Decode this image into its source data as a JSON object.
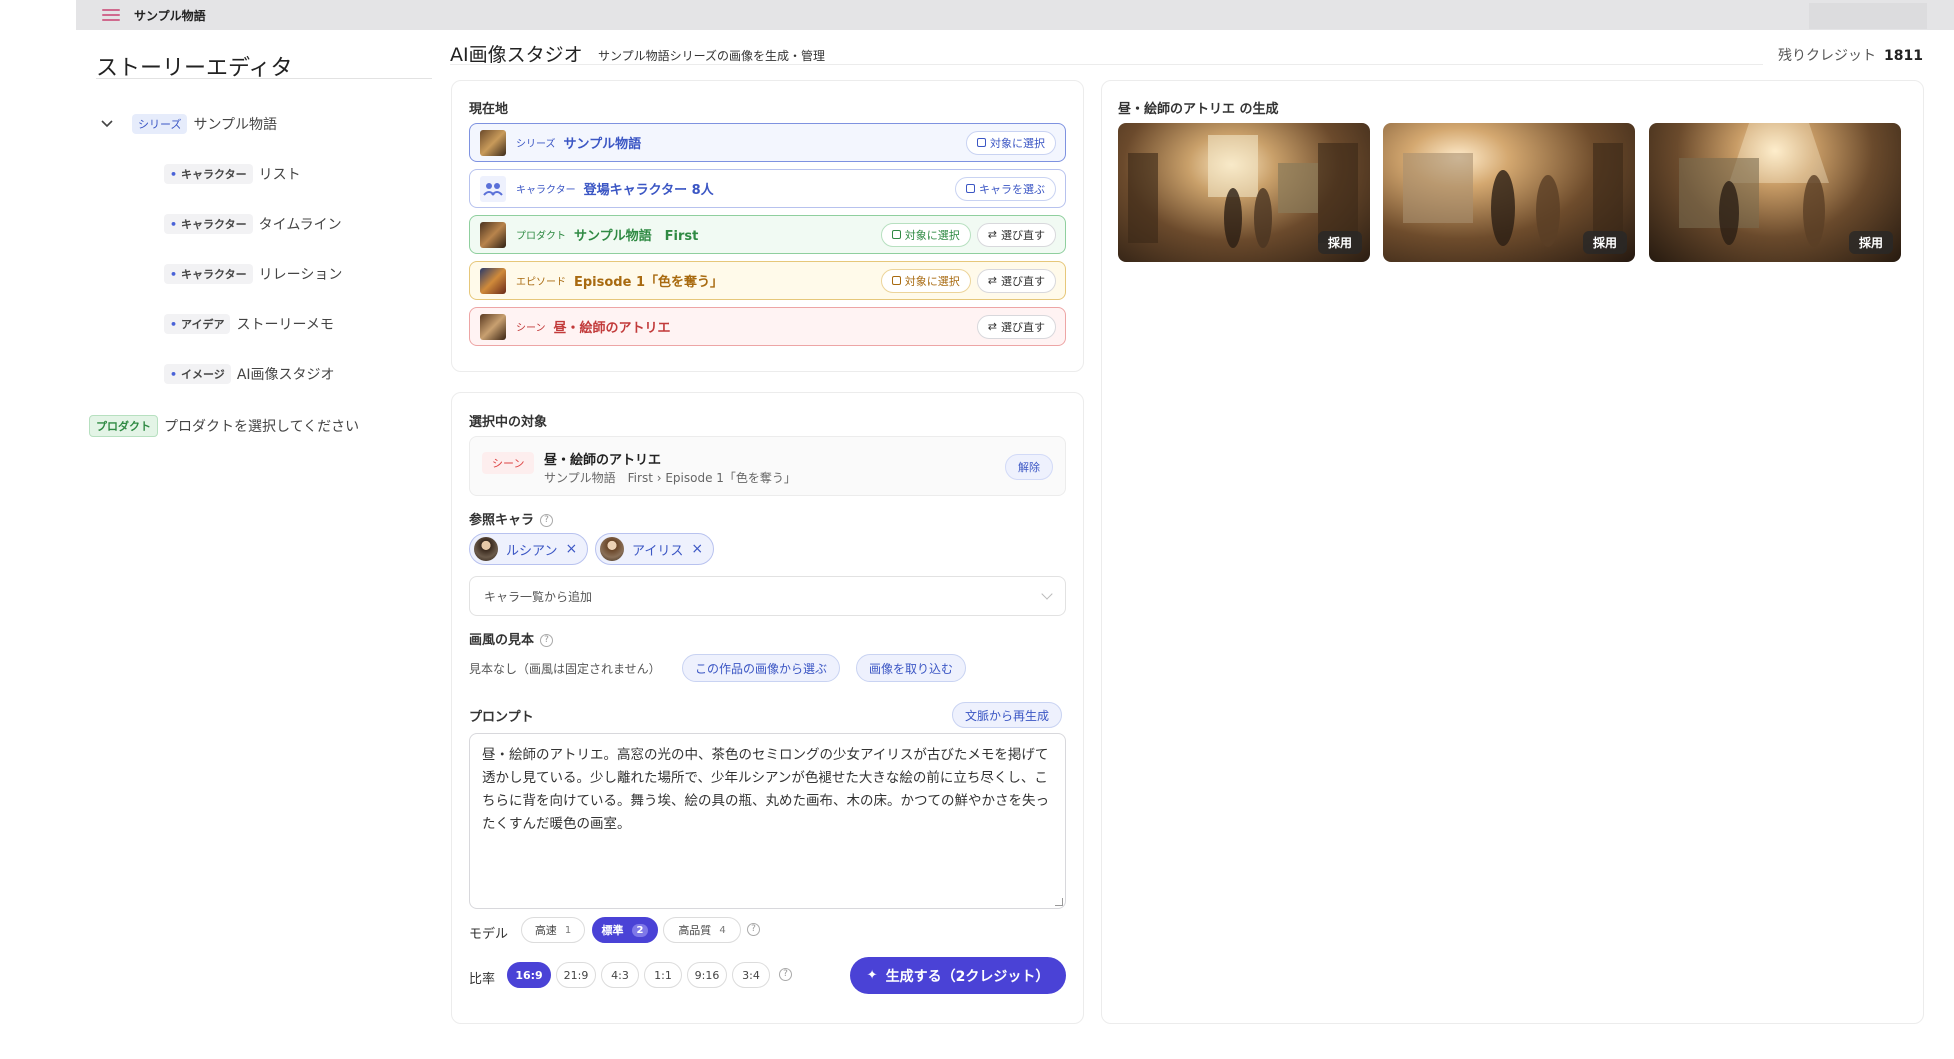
{
  "header": {
    "app_title": "サンプル物語"
  },
  "sidebar": {
    "title": "ストーリーエディタ",
    "series": {
      "tag": "シリーズ",
      "label": "サンプル物語"
    },
    "items": [
      {
        "tag": "キャラクター",
        "label": "リスト"
      },
      {
        "tag": "キャラクター",
        "label": "タイムライン"
      },
      {
        "tag": "キャラクター",
        "label": "リレーション"
      },
      {
        "tag": "アイデア",
        "label": "ストーリーメモ"
      },
      {
        "tag": "イメージ",
        "label": "AI画像スタジオ"
      }
    ],
    "product": {
      "tag": "プロダクト",
      "label": "プロダクトを選択してください"
    }
  },
  "main": {
    "title": "AI画像スタジオ",
    "subtitle": "サンプル物語シリーズの画像を生成・管理",
    "credits_label": "残りクレジット",
    "credits_value": "1811"
  },
  "location": {
    "label": "現在地",
    "rows": [
      {
        "kind": "シリーズ",
        "name": "サンプル物語",
        "color": "#3b56c4",
        "bg": "#f3f6fe",
        "border": "#7e92e0",
        "buttons": [
          "対象に選択"
        ]
      },
      {
        "kind": "キャラクター",
        "name": "登場キャラクター 8人",
        "color": "#3b56c4",
        "bg": "#ffffff",
        "border": "#b7c2ee",
        "buttons": [
          "キャラを選ぶ"
        ]
      },
      {
        "kind": "プロダクト",
        "name": "サンプル物語　First",
        "color": "#2f8a43",
        "bg": "#f1faf3",
        "border": "#8fcf9e",
        "buttons": [
          "対象に選択",
          "選び直す"
        ]
      },
      {
        "kind": "エピソード",
        "name": "Episode 1「色を奪う」",
        "color": "#a86a10",
        "bg": "#fffaea",
        "border": "#e6c77a",
        "buttons": [
          "対象に選択",
          "選び直す"
        ]
      },
      {
        "kind": "シーン",
        "name": "昼・絵師のアトリエ",
        "color": "#c23a3a",
        "bg": "#fff3f3",
        "border": "#eda5a5",
        "buttons": [
          "選び直す"
        ]
      }
    ]
  },
  "selection": {
    "label": "選択中の対象",
    "tag": "シーン",
    "name": "昼・絵師のアトリエ",
    "path": "サンプル物語　First › Episode 1「色を奪う」",
    "release": "解除"
  },
  "refs": {
    "label": "参照キャラ",
    "chips": [
      "ルシアン",
      "アイリス"
    ],
    "add_placeholder": "キャラ一覧から追加"
  },
  "style": {
    "label": "画風の見本",
    "none_text": "見本なし（画風は固定されません）",
    "pick_button": "この作品の画像から選ぶ",
    "import_button": "画像を取り込む"
  },
  "prompt": {
    "label": "プロンプト",
    "regen_button": "文脈から再生成",
    "text": "昼・絵師のアトリエ。高窓の光の中、茶色のセミロングの少女アイリスが古びたメモを掲げて透かし見ている。少し離れた場所で、少年ルシアンが色褪せた大きな絵の前に立ち尽くし、こちらに背を向けている。舞う埃、絵の具の瓶、丸めた画布、木の床。かつての鮮やかさを失ったくすんだ暖色の画室。"
  },
  "model": {
    "label": "モデル",
    "options": [
      {
        "name": "高速",
        "cost": "1",
        "active": false
      },
      {
        "name": "標準",
        "cost": "2",
        "active": true
      },
      {
        "name": "高品質",
        "cost": "4",
        "active": false
      }
    ]
  },
  "ratio": {
    "label": "比率",
    "options": [
      "16:9",
      "21:9",
      "4:3",
      "1:1",
      "9:16",
      "3:4"
    ],
    "active": "16:9"
  },
  "generate_button": "生成する（2クレジット）",
  "results": {
    "title": "昼・絵師のアトリエ の生成",
    "images": [
      {
        "adopt": "採用"
      },
      {
        "adopt": "採用"
      },
      {
        "adopt": "採用"
      }
    ]
  }
}
